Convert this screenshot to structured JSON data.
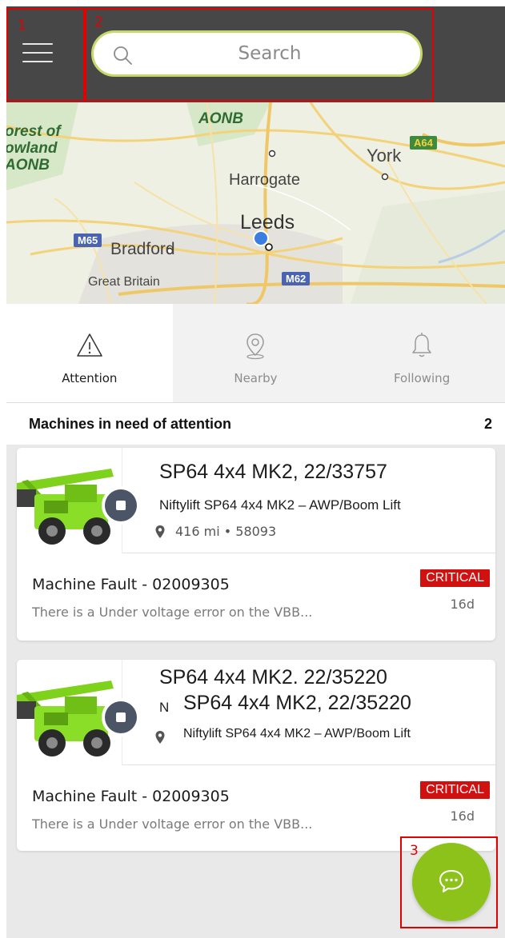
{
  "colors": {
    "header_bg": "#474747",
    "search_border": "#c4d96a",
    "critical": "#d11010",
    "fab": "#8cc21a",
    "annotation": "#e30000"
  },
  "header": {
    "menu_icon": "hamburger-icon",
    "search_placeholder": "Search",
    "search_icon": "search-icon"
  },
  "annotations": [
    "1",
    "2",
    "3"
  ],
  "map": {
    "labels": {
      "aonb_top": "AONB",
      "forest": "orest of\nowland\nAONB",
      "york": "York",
      "harrogate": "Harrogate",
      "leeds": "Leeds",
      "bradford": "Bradford",
      "great_britain": "Great Britain"
    },
    "roads": {
      "a64": "A64",
      "m65": "M65",
      "m62": "M62"
    }
  },
  "tabs": [
    {
      "label": "Attention",
      "icon": "warning-icon",
      "active": true
    },
    {
      "label": "Nearby",
      "icon": "location-pin-icon",
      "active": false
    },
    {
      "label": "Following",
      "icon": "bell-icon",
      "active": false
    }
  ],
  "section": {
    "title": "Machines in need of attention",
    "count": "2"
  },
  "cards": [
    {
      "title": "SP64 4x4 MK2, 22/33757",
      "subtitle": "Niftylift SP64 4x4 MK2 – AWP/Boom Lift",
      "meta": "416 mi • 58093",
      "fault_title": "Machine Fault - 02009305",
      "fault_desc": "There is a Under voltage error on the VBB...",
      "badge": "CRITICAL",
      "age": "16d"
    },
    {
      "title_a": "SP64 4x4 MK2. 22/35220",
      "prefix": "N",
      "title_b": "SP64 4x4 MK2, 22/35220",
      "subtitle": "Niftylift SP64 4x4 MK2 – AWP/Boom Lift",
      "fault_title": "Machine Fault - 02009305",
      "fault_desc": "There is a Under voltage error on the VBB...",
      "badge": "CRITICAL",
      "age": "16d"
    }
  ],
  "fab": {
    "icon": "chat-bubbles-icon"
  }
}
